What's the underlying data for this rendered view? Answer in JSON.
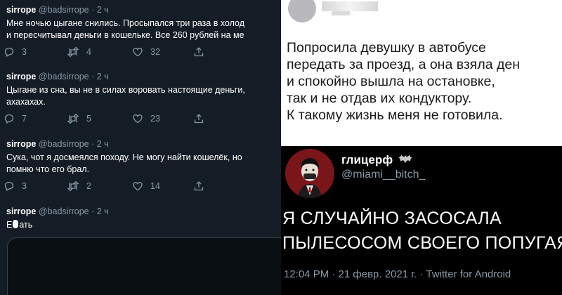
{
  "left_thread": {
    "tweets": [
      {
        "name": "sirrope",
        "handle": "@badsirrope",
        "time": "· 2 ч",
        "lines": [
          "Мне ночью цыгане снились. Просыпался три раза в холод",
          "и пересчитывал деньги в кошельке. Все 260 рублей на ме"
        ],
        "replies": "3",
        "retweets": "4",
        "likes": "32"
      },
      {
        "name": "sirrope",
        "handle": "@badsirrope",
        "time": "· 2 ч",
        "lines": [
          "Цыгане из сна, вы не в силах воровать настоящие деньги,",
          "ахахахах."
        ],
        "replies": "7",
        "retweets": "5",
        "likes": "23"
      },
      {
        "name": "sirrope",
        "handle": "@badsirrope",
        "time": "· 2 ч",
        "lines": [
          "Сука, чот я досмеялся походу. Не могу найти кошелёк, но",
          "помню что его брал."
        ],
        "replies": "3",
        "retweets": "2",
        "likes": "14"
      },
      {
        "name": "sirrope",
        "handle": "@badsirrope",
        "time": "· 2 ч",
        "text_start": "Е",
        "text_end": "ать"
      }
    ]
  },
  "top_right": {
    "lines": [
      "Попросила девушку в автобусе",
      "передать за проезд, а она взяла ден",
      "и спокойно вышла на остановке,",
      "так и не отдав их кондуктору.",
      "К такому жизнь меня не готовила."
    ]
  },
  "bottom_right": {
    "name": "глицерф",
    "handle": "@miami__bitch_",
    "lines": [
      "Я СЛУЧАЙНО ЗАСОСАЛА",
      "ПЫЛЕСОСОМ СВОЕГО ПОПУГАЯ"
    ],
    "meta": "12:04 PM · 21 февр. 2021 г. · Twitter for Android"
  },
  "colors": {
    "dark_bg": "#141d26",
    "muted": "#8899a6",
    "black_bg": "#000000"
  },
  "icons": [
    "reply-icon",
    "retweet-icon",
    "like-icon",
    "share-icon",
    "bat-emoji-icon"
  ]
}
